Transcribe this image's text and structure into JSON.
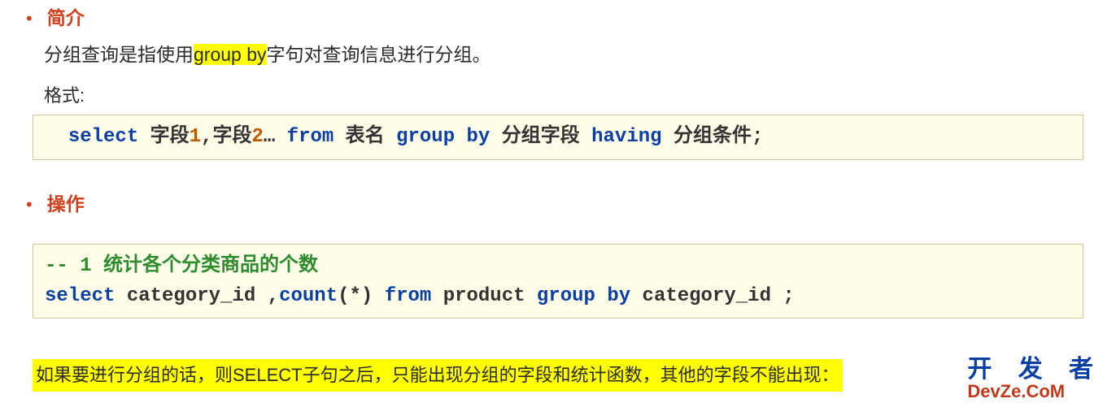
{
  "section1": {
    "title": "简介",
    "intro_pre": "分组查询是指使用",
    "intro_highlight": "group by",
    "intro_post": "字句对查询信息进行分组。",
    "format_label": "格式:",
    "code": {
      "select": "select",
      "field_a": " 字段",
      "one": "1",
      "comma": ",字段",
      "two": "2",
      "dots": "… ",
      "from": "from",
      "table": " 表名 ",
      "groupby": "group by",
      "grpfield": " 分组字段 ",
      "having": "having",
      "cond": " 分组条件;"
    }
  },
  "section2": {
    "title": "操作",
    "code": {
      "comment": "-- 1 统计各个分类商品的个数",
      "select": "select",
      "mid1": " category_id ,",
      "count": "count",
      "paren": "(*) ",
      "from": "from",
      "mid2": " product ",
      "groupby": "group by",
      "mid3": " category_id ;"
    }
  },
  "note": "如果要进行分组的话，则SELECT子句之后，只能出现分组的字段和统计函数，其他的字段不能出现：",
  "watermark": {
    "top": "开 发 者",
    "bottom": "DevZe.CoM"
  }
}
